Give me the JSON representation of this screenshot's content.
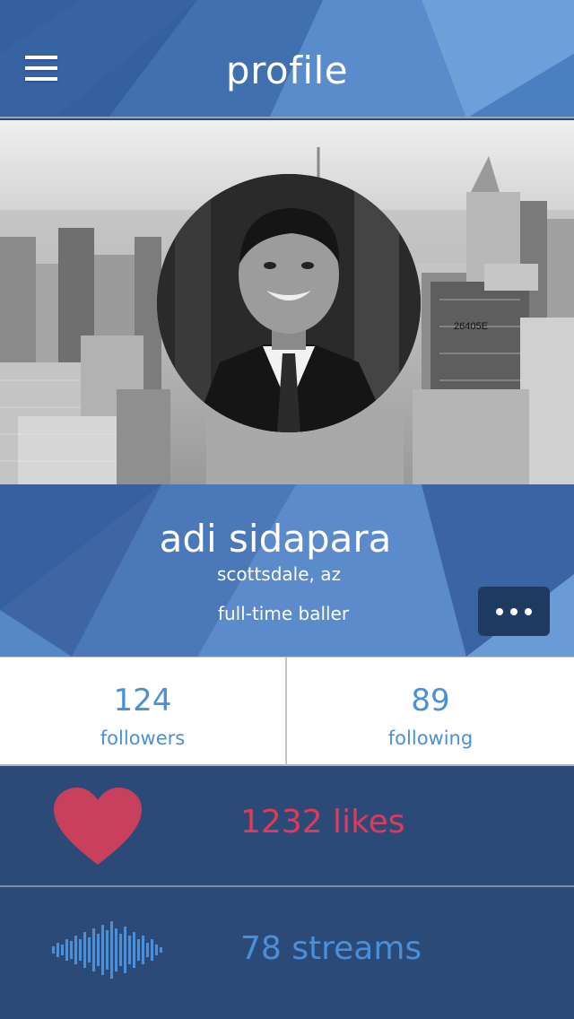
{
  "header": {
    "title": "profile",
    "menu_icon": "hamburger-menu-icon"
  },
  "hero": {
    "background": "grayscale city skyline photo",
    "avatar_icon": "profile-photo",
    "watermark": "26405E"
  },
  "profile": {
    "name": "adi sidapara",
    "location": "scottsdale, az",
    "bio": "full-time baller",
    "more_icon": "more-dots-icon"
  },
  "stats": {
    "followers_count": "124",
    "followers_label": "followers",
    "following_count": "89",
    "following_label": "following"
  },
  "activity": {
    "likes_text": "1232 likes",
    "likes_icon": "heart-icon",
    "streams_text": "78 streams",
    "streams_icon": "waveform-icon"
  },
  "colors": {
    "header_blue": "#3d68a8",
    "dark_panel": "#2b4a78",
    "accent_blue": "#4a90d9",
    "likes_red": "#e03a58",
    "more_button": "#1e3a60"
  }
}
